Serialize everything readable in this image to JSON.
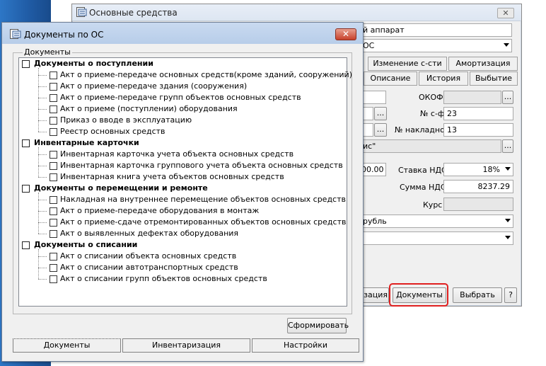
{
  "back_window": {
    "title": "Основные средства",
    "name_value_fragment": "й аппарат",
    "select_value_fragment": "ОС",
    "tabs_row1": [
      "Изменение с-сти",
      "Амортизация"
    ],
    "tabs_row2": [
      "Описание",
      "История",
      "Выбытие"
    ],
    "okof_label": "ОКОФ",
    "nsf_label": "№ с-ф",
    "nsf_value": "23",
    "nnakl_label": "№ накладной",
    "nnakl_value": "13",
    "supplier_fragment": "ис\"",
    "amount_fragment": "00.00",
    "vat_rate_label": "Ставка НДС",
    "vat_rate_value": "18%",
    "vat_sum_label": "Сумма НДС",
    "vat_sum_value": "8237.29",
    "rate_label": "Курс",
    "currency_fragment": "рубль",
    "bottom_left_fragment": "изация",
    "documents_button": "Документы",
    "choose_button": "Выбрать",
    "help_button": "?",
    "ellipsis": "..."
  },
  "dialog": {
    "title": "Документы по ОС",
    "close": "✕",
    "group_label": "Документы",
    "generate_button": "Сформировать",
    "bottom_tabs": [
      "Документы",
      "Инвентаризация",
      "Настройки"
    ],
    "tree": [
      {
        "label": "Документы о поступлении",
        "children": [
          "Акт о приеме-передаче основных средств(кроме зданий, сооружений)",
          "Акт о приеме-передаче здания (сооружения)",
          "Акт о приеме-передаче групп объектов основных средств",
          "Акт о приеме (поступлении) оборудования",
          "Приказ о вводе в эксплуатацию",
          "Реестр основных средств"
        ]
      },
      {
        "label": "Инвентарные карточки",
        "children": [
          "Инвентарная карточка учета объекта основных средств",
          "Инвентарная карточка группового учета объекта основных средств",
          "Инвентарная книга учета объектов основных средств"
        ]
      },
      {
        "label": "Документы о перемещении и ремонте",
        "children": [
          "Накладная на внутреннее перемещение объектов основных средств",
          "Акт о приеме-передаче оборудования в монтаж",
          "Акт о приеме-сдаче отремонтированных объектов основных средств",
          "Акт о выявленных дефектах оборудования"
        ]
      },
      {
        "label": "Документы о списании",
        "children": [
          "Акт о списании объекта основных средств",
          "Акт о списании автотранспортных средств",
          "Акт о списании групп объектов основных средств"
        ]
      }
    ]
  }
}
